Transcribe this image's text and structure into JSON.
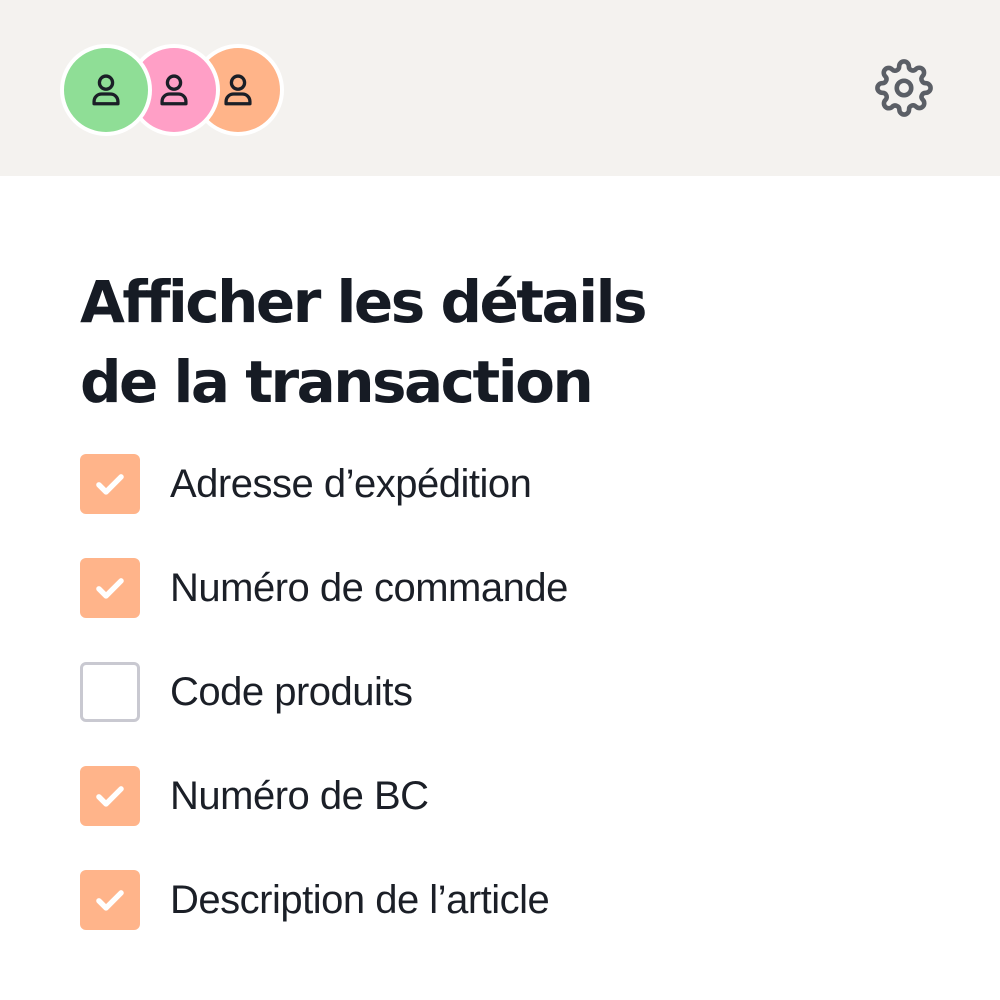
{
  "header": {
    "avatars": [
      {
        "name": "avatar-1",
        "color": "#8fde96",
        "icon": "user-icon"
      },
      {
        "name": "avatar-2",
        "color": "#ff9fc6",
        "icon": "user-icon"
      },
      {
        "name": "avatar-3",
        "color": "#ffb489",
        "icon": "user-icon"
      }
    ],
    "settings_icon": "gear-icon"
  },
  "main": {
    "title": "Afficher les détails de la transaction",
    "options": [
      {
        "label": "Adresse d’expédition",
        "checked": true
      },
      {
        "label": "Numéro de commande",
        "checked": true
      },
      {
        "label": "Code produits",
        "checked": false
      },
      {
        "label": "Numéro de BC",
        "checked": true
      },
      {
        "label": "Description de l’article",
        "checked": true
      }
    ]
  },
  "colors": {
    "header_bg": "#f4f2ef",
    "checkbox_checked": "#ffb48a",
    "checkbox_unchecked_border": "#c9c9d1",
    "text": "#1b1f27"
  }
}
